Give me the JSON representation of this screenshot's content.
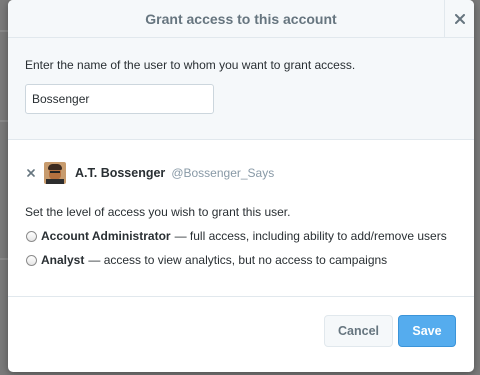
{
  "dialog": {
    "title": "Grant access to this account",
    "close_icon": "close-icon"
  },
  "search": {
    "prompt": "Enter the name of the user to whom you want to grant access.",
    "value": "Bossenger"
  },
  "selected_user": {
    "remove_icon": "remove-icon",
    "name": "A.T. Bossenger",
    "handle": "@Bossenger_Says"
  },
  "access": {
    "prompt": "Set the level of access you wish to grant this user.",
    "options": [
      {
        "label": "Account Administrator",
        "description": "— full access, including ability to add/remove users",
        "selected": false
      },
      {
        "label": "Analyst",
        "description": "— access to view analytics, but no access to campaigns",
        "selected": false
      }
    ]
  },
  "footer": {
    "cancel_label": "Cancel",
    "save_label": "Save"
  },
  "colors": {
    "accent": "#55acee",
    "header_bg": "#f5f8fa",
    "text": "#292f33",
    "muted": "#8899a6"
  }
}
